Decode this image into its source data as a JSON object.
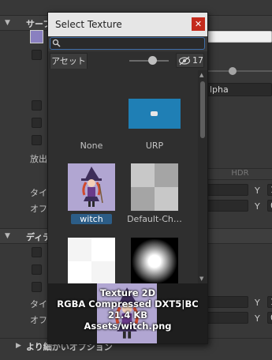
{
  "background": {
    "surface_section_label": "サーフ",
    "detail_section_label": "ディテ",
    "advanced_section_label": "より細かいオプション",
    "emission_label": "放出",
    "tiling_label": "タイリ",
    "offset_label": "オフセ",
    "tiling2_label": "タイリ",
    "offset2_label": "オフセ",
    "alpha_dropdown_value": "lpha",
    "hdr_label": "HDR",
    "x_label_1": "Y",
    "x_label_2": "Y",
    "x_label_3": "Y",
    "x_label_4": "Y",
    "value_1": "1",
    "value_2": "0",
    "value_3": "1",
    "value_4": "0"
  },
  "popup": {
    "title": "Select Texture",
    "close_icon": "close-icon",
    "search": {
      "value": "",
      "placeholder": ""
    },
    "assets_tab": "アセット",
    "zoom_slider_level": 0.5,
    "hidden_count": "17",
    "items": [
      {
        "label": "None",
        "selected": false
      },
      {
        "label": "URP",
        "selected": false
      },
      {
        "label": "witch",
        "selected": true
      },
      {
        "label": "Default-Ch…",
        "selected": false
      },
      {
        "label": "",
        "selected": false
      },
      {
        "label": "",
        "selected": false
      }
    ],
    "preview": {
      "line1": "Texture 2D",
      "line2": "RGBA Compressed DXT5|BC",
      "line3": "21.4 KB",
      "line4": "Assets/witch.png"
    }
  },
  "colors": {
    "selection": "#2c5d87",
    "close": "#c42b1c",
    "focus_border": "#3f6ea8",
    "urp_tile": "#1f7fb5"
  }
}
